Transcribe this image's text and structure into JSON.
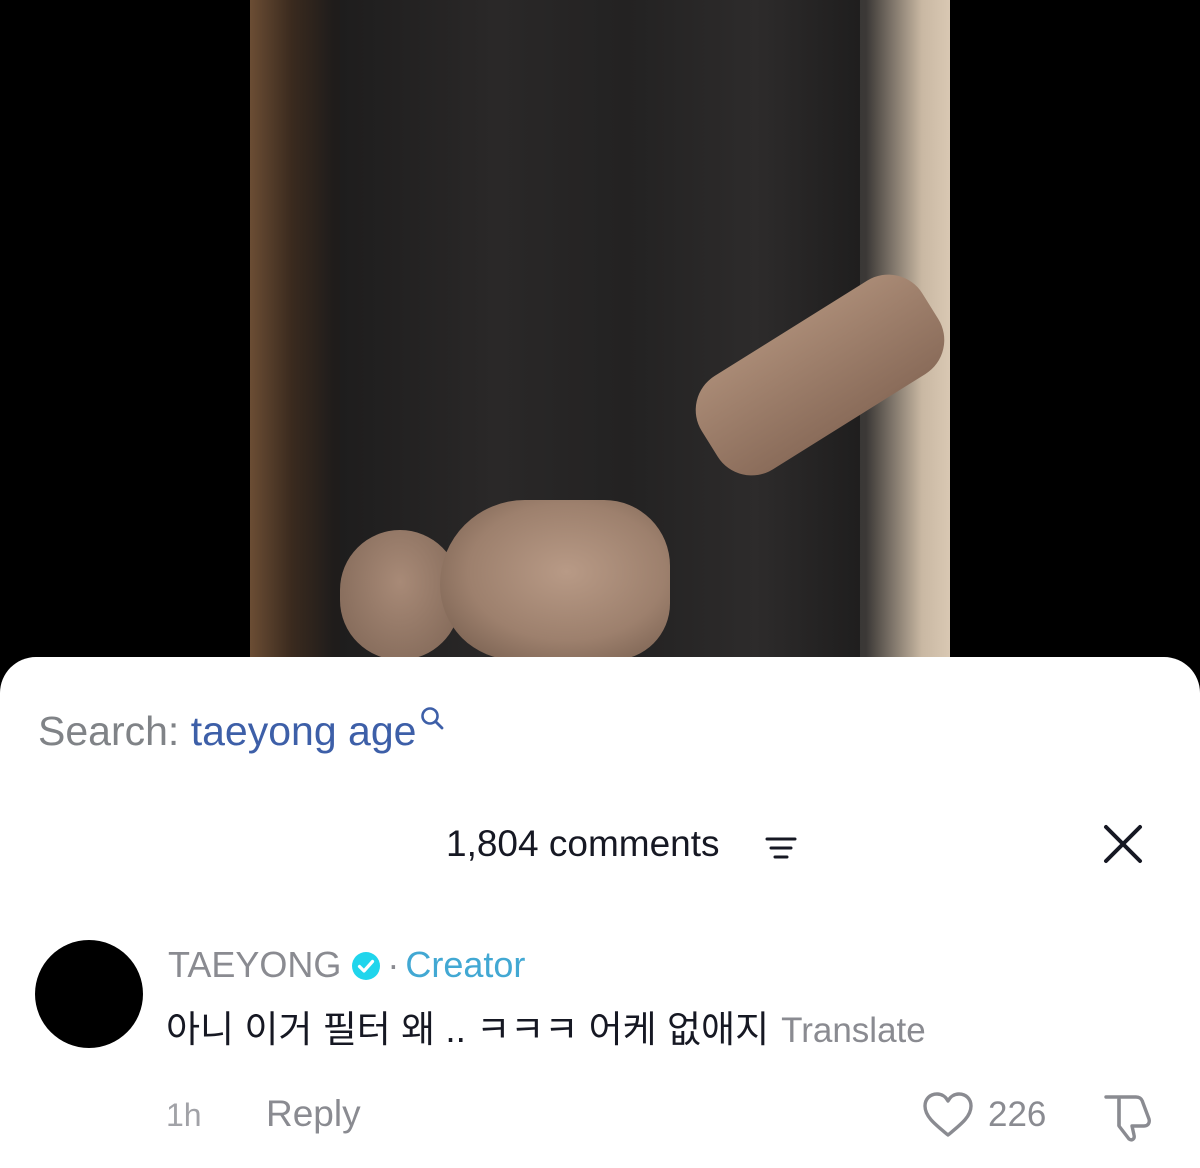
{
  "search": {
    "label": "Search:",
    "query": "taeyong age"
  },
  "comments_header": {
    "count_label": "1,804 comments"
  },
  "comment": {
    "author": "TAEYONG",
    "separator": "·",
    "badge": "Creator",
    "text": "아니 이거 필터 왜 .. ㅋㅋㅋ 어케 없애지",
    "translate_label": "Translate",
    "time": "1h",
    "reply_label": "Reply",
    "like_count": "226"
  },
  "colors": {
    "query": "#3d5fa8",
    "creator": "#42a8d3",
    "verified": "#20d5ec"
  }
}
